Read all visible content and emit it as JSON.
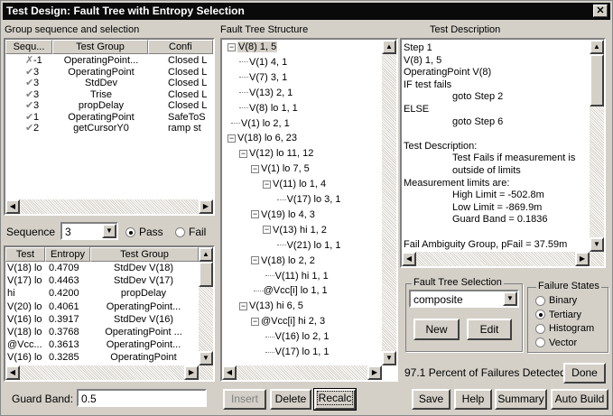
{
  "title": "Test Design: Fault Tree with Entropy Selection",
  "close_icon": "✕",
  "labels": {
    "group_seq": "Group sequence and selection",
    "fault_tree": "Fault Tree Structure",
    "test_desc": "Test Description",
    "sequence": "Sequence",
    "pass": "Pass",
    "fail": "Fail",
    "guard_band": "Guard Band:",
    "fts": "Fault Tree Selection",
    "failure_states": "Failure States",
    "detected": "97.1 Percent of Failures Detected"
  },
  "seq_table": {
    "headers": [
      "Sequ...",
      "Test Group",
      "Confi"
    ],
    "rows": [
      {
        "mark": "✗",
        "seq": "-1",
        "group": "OperatingPoint...",
        "conf": "Closed L"
      },
      {
        "mark": "✔",
        "seq": "3",
        "group": "OperatingPoint",
        "conf": "Closed L"
      },
      {
        "mark": "✔",
        "seq": "3",
        "group": "StdDev",
        "conf": "Closed L"
      },
      {
        "mark": "✔",
        "seq": "3",
        "group": "Trise",
        "conf": "Closed L"
      },
      {
        "mark": "✔",
        "seq": "3",
        "group": "propDelay",
        "conf": "Closed L"
      },
      {
        "mark": "✔",
        "seq": "1",
        "group": "OperatingPoint",
        "conf": "SafeToS"
      },
      {
        "mark": "✔",
        "seq": "2",
        "group": "getCursorY0",
        "conf": "ramp st"
      }
    ]
  },
  "sequence_value": "3",
  "entropy_table": {
    "headers": [
      "Test",
      "Entropy",
      "Test Group"
    ],
    "rows": [
      {
        "test": "V(18) lo",
        "entropy": "0.4709",
        "group": "StdDev V(18)"
      },
      {
        "test": "V(17) lo",
        "entropy": "0.4463",
        "group": "StdDev V(17)"
      },
      {
        "test": "hi",
        "entropy": "0.4200",
        "group": "propDelay"
      },
      {
        "test": "V(20) lo",
        "entropy": "0.4061",
        "group": "OperatingPoint..."
      },
      {
        "test": "V(16) lo",
        "entropy": "0.3917",
        "group": "StdDev V(16)"
      },
      {
        "test": "V(18) lo",
        "entropy": "0.3768",
        "group": "OperatingPoint ..."
      },
      {
        "test": "@Vcc...",
        "entropy": "0.3613",
        "group": "OperatingPoint..."
      },
      {
        "test": "V(16) lo",
        "entropy": "0.3285",
        "group": "OperatingPoint"
      }
    ]
  },
  "guard_band_value": "0.5",
  "tree": [
    {
      "text": "V(8) 1, 5",
      "indent": 0,
      "box": "−",
      "sel": true
    },
    {
      "text": "V(1) 4, 1",
      "indent": 1,
      "box": ""
    },
    {
      "text": "V(7) 3, 1",
      "indent": 1,
      "box": ""
    },
    {
      "text": "V(13) 2, 1",
      "indent": 1,
      "box": ""
    },
    {
      "text": "V(8) lo 1, 1",
      "indent": 1,
      "box": ""
    },
    {
      "text": "V(1) lo 2, 1",
      "indent": 0.3,
      "box": ""
    },
    {
      "text": "V(18) lo 6, 23",
      "indent": 0,
      "box": "−"
    },
    {
      "text": "V(12) lo 11, 12",
      "indent": 1,
      "box": "−"
    },
    {
      "text": "V(1) lo 7, 5",
      "indent": 2,
      "box": "−"
    },
    {
      "text": "V(11) lo 1, 4",
      "indent": 3,
      "box": "−"
    },
    {
      "text": "V(17) lo 3, 1",
      "indent": 4.2,
      "box": ""
    },
    {
      "text": "V(19) lo 4, 3",
      "indent": 2,
      "box": "−"
    },
    {
      "text": "V(13) hi 1, 2",
      "indent": 3,
      "box": "−"
    },
    {
      "text": "V(21) lo 1, 1",
      "indent": 4.2,
      "box": ""
    },
    {
      "text": "V(18) lo 2, 2",
      "indent": 2,
      "box": "−"
    },
    {
      "text": "V(11) hi 1, 1",
      "indent": 3.2,
      "box": ""
    },
    {
      "text": "@Vcc[i] lo 1, 1",
      "indent": 2.2,
      "box": ""
    },
    {
      "text": "V(13) hi 6, 5",
      "indent": 1,
      "box": "−"
    },
    {
      "text": "@Vcc[i] hi 2, 3",
      "indent": 2,
      "box": "−"
    },
    {
      "text": "V(16) lo 2, 1",
      "indent": 3.2,
      "box": ""
    },
    {
      "text": "V(17) lo 1, 1",
      "indent": 3.2,
      "box": ""
    }
  ],
  "description": [
    {
      "text": "Step 1",
      "indent": 0
    },
    {
      "text": "V(8) 1, 5",
      "indent": 0
    },
    {
      "text": "OperatingPoint V(8)",
      "indent": 0
    },
    {
      "text": "IF test fails",
      "indent": 0
    },
    {
      "text": "goto Step 2",
      "indent": 1
    },
    {
      "text": "ELSE",
      "indent": 0
    },
    {
      "text": "goto Step 6",
      "indent": 1
    },
    {
      "text": "",
      "indent": 0
    },
    {
      "text": "Test Description:",
      "indent": 0
    },
    {
      "text": "Test Fails if measurement is",
      "indent": 1
    },
    {
      "text": "outside of limits",
      "indent": 1
    },
    {
      "text": "Measurement limits are:",
      "indent": 0
    },
    {
      "text": "High Limit = -502.8m",
      "indent": 1
    },
    {
      "text": "Low Limit = -869.9m",
      "indent": 1
    },
    {
      "text": "Guard Band = 0.1836",
      "indent": 1
    },
    {
      "text": "",
      "indent": 0
    },
    {
      "text": "Fail Ambiguity Group, pFail = 37.59m",
      "indent": 0
    }
  ],
  "fts_value": "composite",
  "failure_states": [
    "Binary",
    "Tertiary",
    "Histogram",
    "Vector"
  ],
  "failure_selected": 1,
  "buttons": {
    "new": "New",
    "edit": "Edit",
    "done": "Done",
    "insert": "Insert",
    "delete": "Delete",
    "recalc": "Recalc",
    "save": "Save",
    "help": "Help",
    "summary": "Summary",
    "auto_build": "Auto Build"
  }
}
